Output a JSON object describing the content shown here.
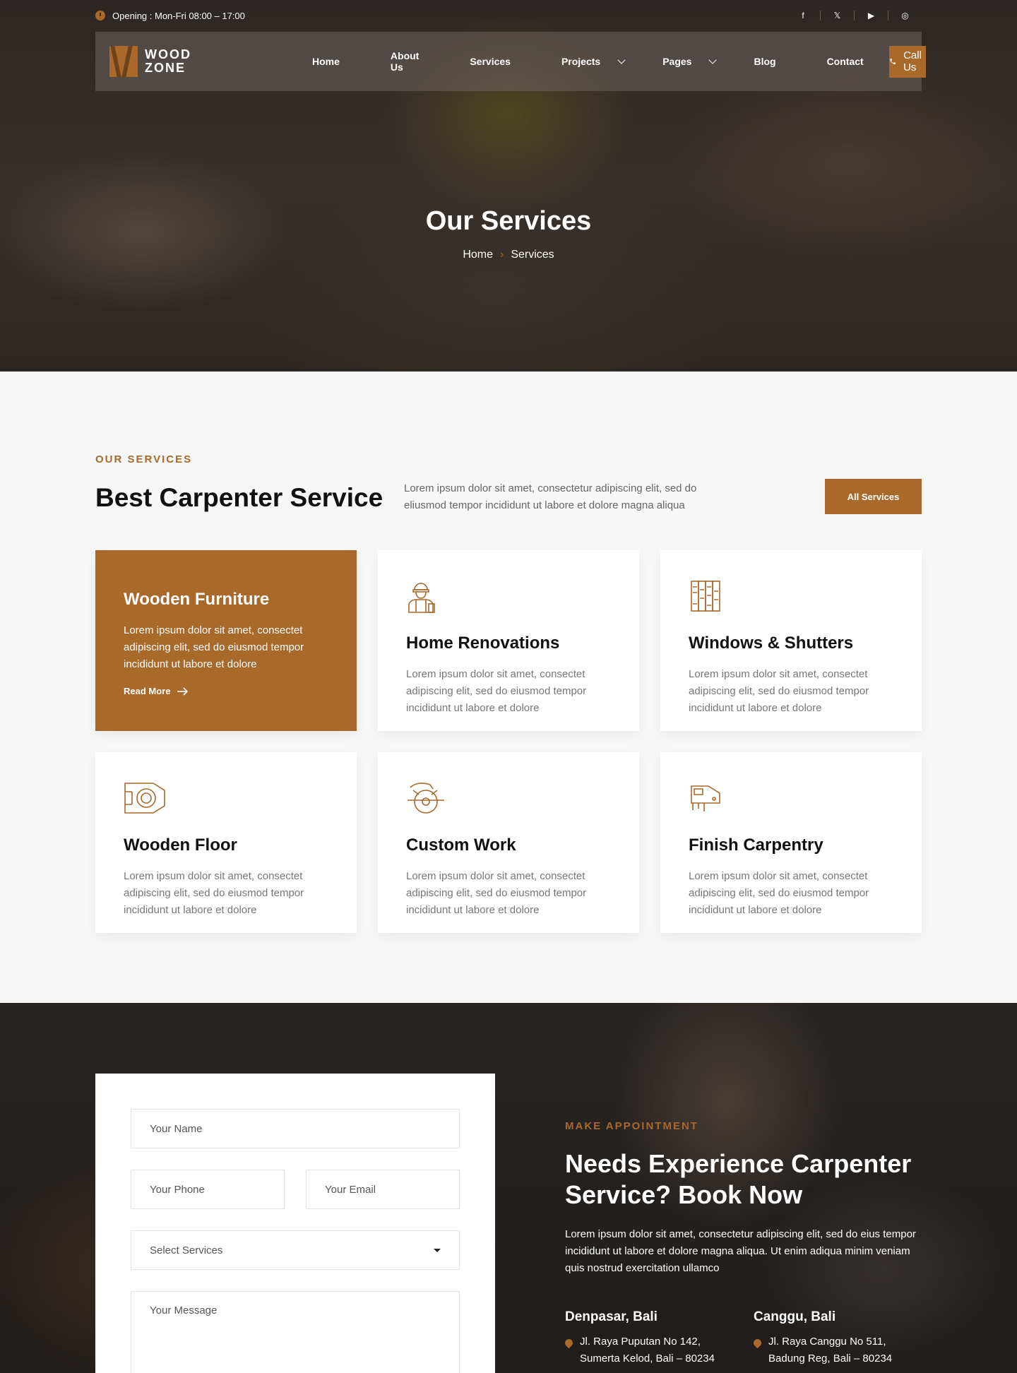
{
  "topbar": {
    "opening": "Opening : Mon-Fri 08:00 – 17:00",
    "socials": [
      "f",
      "𝕏",
      "▶",
      "◎"
    ]
  },
  "nav": {
    "logo_line1": "WOOD",
    "logo_line2": "ZONE",
    "items": [
      "Home",
      "About Us",
      "Services",
      "Projects",
      "Pages",
      "Blog",
      "Contact"
    ],
    "call_label": "Call Us"
  },
  "hero": {
    "title": "Our Services",
    "breadcrumb_home": "Home",
    "breadcrumb_current": "Services"
  },
  "services": {
    "eyebrow": "OUR SERVICES",
    "title": "Best Carpenter Service",
    "description": "Lorem ipsum dolor sit amet, consectetur adipiscing elit, sed do eliusmod tempor incididunt ut labore et dolore magna aliqua",
    "all_button": "All Services",
    "read_more": "Read More",
    "cards": [
      {
        "title": "Wooden Furniture",
        "text": "Lorem ipsum dolor sit amet, consectet adipiscing elit, sed do eiusmod tempor incididunt ut labore et dolore",
        "icon": "furniture-icon"
      },
      {
        "title": "Home Renovations",
        "text": "Lorem ipsum dolor sit amet, consectet adipiscing elit, sed do eiusmod tempor incididunt ut labore et dolore",
        "icon": "worker-icon"
      },
      {
        "title": "Windows & Shutters",
        "text": "Lorem ipsum dolor sit amet, consectet adipiscing elit, sed do eiusmod tempor incididunt ut labore et dolore",
        "icon": "shutters-icon"
      },
      {
        "title": "Wooden Floor",
        "text": "Lorem ipsum dolor sit amet, consectet adipiscing elit, sed do eiusmod tempor incididunt ut labore et dolore",
        "icon": "floor-tape-icon"
      },
      {
        "title": "Custom Work",
        "text": "Lorem ipsum dolor sit amet, consectet adipiscing elit, sed do eiusmod tempor incididunt ut labore et dolore",
        "icon": "circular-saw-icon"
      },
      {
        "title": "Finish Carpentry",
        "text": "Lorem ipsum dolor sit amet, consectet adipiscing elit, sed do eiusmod tempor incididunt ut labore et dolore",
        "icon": "jigsaw-icon"
      }
    ]
  },
  "form": {
    "name_placeholder": "Your  Name",
    "phone_placeholder": "Your Phone",
    "email_placeholder": "Your Email",
    "select_placeholder": "Select Services",
    "message_placeholder": "Your Message"
  },
  "appointment": {
    "eyebrow": "MAKE APPOINTMENT",
    "title": "Needs Experience Carpenter Service? Book Now",
    "description": "Lorem ipsum dolor sit amet, consectetur adipiscing elit, sed do eius tempor incididunt ut labore et dolore magna aliqua. Ut enim adiqua minim veniam quis nostrud exercitation ullamco",
    "locations": [
      {
        "city": "Denpasar, Bali",
        "address_line1": "Jl. Raya Puputan No 142,",
        "address_line2": "Sumerta Kelod, Bali – 80234"
      },
      {
        "city": "Canggu, Bali",
        "address_line1": "Jl. Raya Canggu No 511,",
        "address_line2": "Badung Reg, Bali – 80234"
      }
    ]
  },
  "colors": {
    "accent": "#a8692a",
    "active_nav": "#c89252"
  }
}
